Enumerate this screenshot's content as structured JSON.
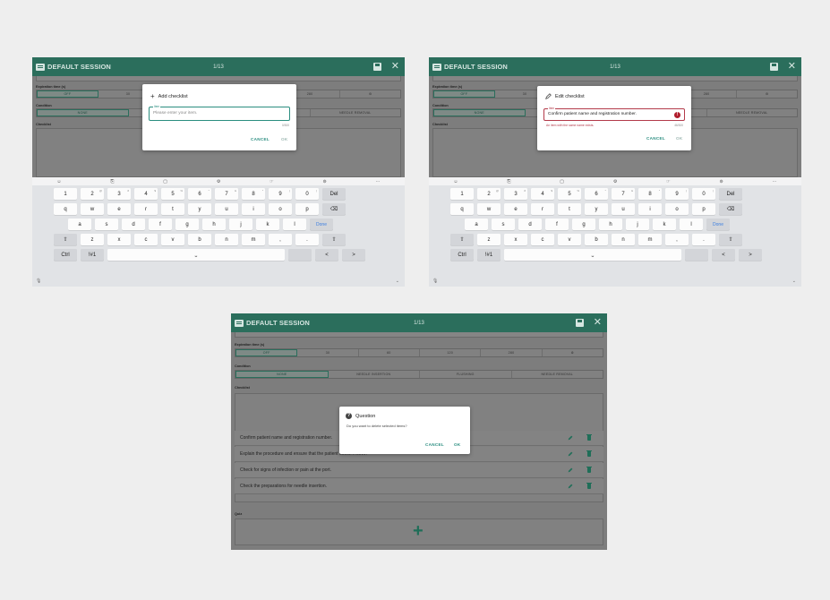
{
  "app": {
    "title": "DEFAULT SESSION",
    "counter": "1/13",
    "close_glyph": "✕"
  },
  "sections": {
    "expiration_label": "Expiration time (s)",
    "expiration_options": [
      "OFF",
      "30",
      "60",
      "120",
      "280",
      "⚙"
    ],
    "condition_label": "Condition",
    "condition_options": [
      "NONE",
      "NEEDLE INSERTION",
      "FLUSHING",
      "NEEDLE REMOVAL"
    ],
    "checklist_label": "Checklist",
    "quiz_label": "Quiz"
  },
  "add_dialog": {
    "title": "Add checklist",
    "field_label": "Item",
    "placeholder": "Please enter your item.",
    "counter": "0/300",
    "cancel": "CANCEL",
    "ok": "OK"
  },
  "edit_dialog": {
    "title": "Edit checklist",
    "field_label": "Item",
    "value": "Confirm patient name and registration number.",
    "error": "An item with the same name exists.",
    "counter": "46/300",
    "cancel": "CANCEL",
    "ok": "OK"
  },
  "question_dialog": {
    "title": "Question",
    "message": "Do you want to delete selected items?",
    "cancel": "CANCEL",
    "ok": "OK"
  },
  "checklist_items": [
    "Confirm patient name and registration number.",
    "Explain the procedure and ensure that the patient doesn't move.",
    "Check for signs of infection or pain at the port.",
    "Check the preparations for needle insertion."
  ],
  "keyboard": {
    "toolbar": [
      "☺",
      "⎘",
      "▢",
      "⚙",
      "☞",
      "⊚",
      "···"
    ],
    "row1": [
      [
        "1",
        ""
      ],
      [
        "2",
        "@"
      ],
      [
        "3",
        "#"
      ],
      [
        "4",
        "$"
      ],
      [
        "5",
        "%"
      ],
      [
        "6",
        "^"
      ],
      [
        "7",
        "&"
      ],
      [
        "8",
        "*"
      ],
      [
        "9",
        "("
      ],
      [
        "0",
        ")"
      ]
    ],
    "del": "Del",
    "row2": [
      "q",
      "w",
      "e",
      "r",
      "t",
      "y",
      "u",
      "i",
      "o",
      "p"
    ],
    "backspace": "⌫",
    "row3": [
      "a",
      "s",
      "d",
      "f",
      "g",
      "h",
      "j",
      "k",
      "l"
    ],
    "done": "Done",
    "row4": [
      "z",
      "x",
      "c",
      "v",
      "b",
      "n",
      "m"
    ],
    "shift": "⇧",
    "ctrl": "Ctrl",
    "sym": "!#1",
    "space": "⎵",
    "left": "<",
    "right": ">",
    "mic": "🎙",
    "collapse": "⌄"
  },
  "colors": {
    "appbar": "#2b6e5c",
    "accent": "#2b8e80",
    "error": "#b01e2d"
  }
}
